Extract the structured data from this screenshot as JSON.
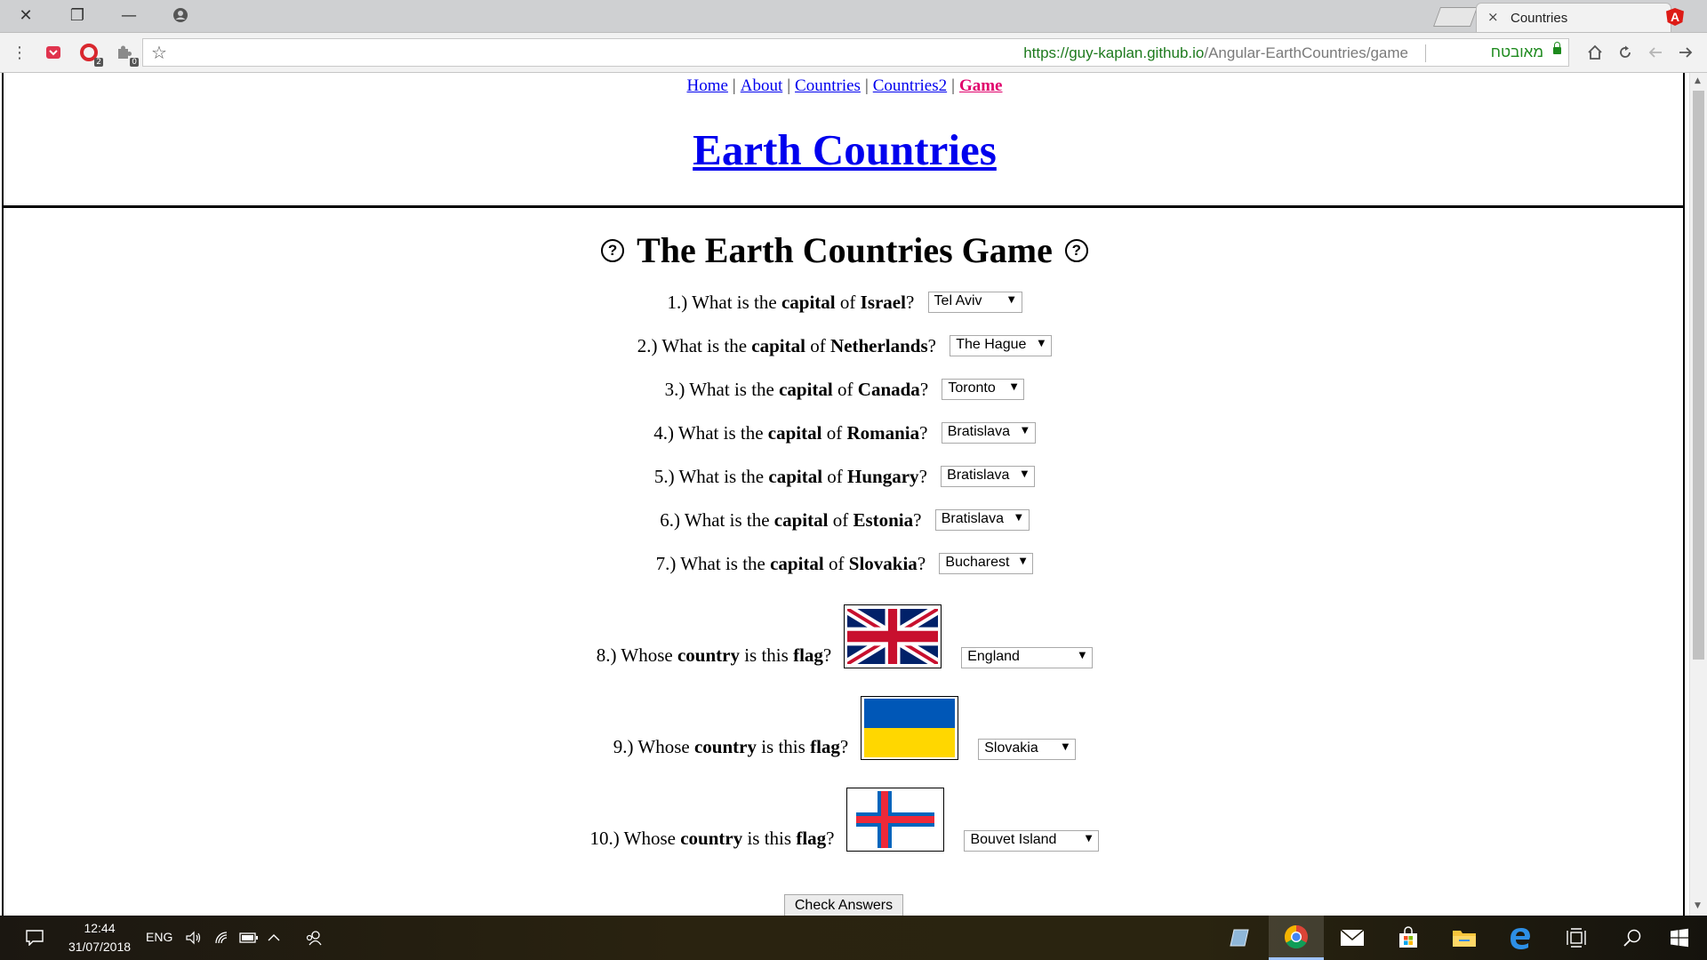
{
  "browser": {
    "tab_title": "Countries",
    "tab_close": "×",
    "favicon_letter": "A",
    "url_host": "https://guy-kaplan.github.io",
    "url_path": "/Angular-EarthCountries/game",
    "secure_label": "מאובטח",
    "window_controls": {
      "close": "✕",
      "restore": "❐",
      "minimize": "—"
    },
    "extension_badges": [
      "2",
      "0"
    ]
  },
  "page": {
    "nav": [
      {
        "label": "Home",
        "active": false
      },
      {
        "label": "About",
        "active": false
      },
      {
        "label": "Countries",
        "active": false
      },
      {
        "label": "Countries2",
        "active": false
      },
      {
        "label": "Game",
        "active": true
      }
    ],
    "nav_separator": "|",
    "site_title": "Earth Countries",
    "game_title": "The Earth Countries Game",
    "help_glyph": "?",
    "capital_questions": [
      {
        "num": "1.)",
        "pre": "What is the",
        "bold1": "capital",
        "mid": "of",
        "bold2": "Israel",
        "post": "?",
        "answer": "Tel Aviv"
      },
      {
        "num": "2.)",
        "pre": "What is the",
        "bold1": "capital",
        "mid": "of",
        "bold2": "Netherlands",
        "post": "?",
        "answer": "The Hague"
      },
      {
        "num": "3.)",
        "pre": "What is the",
        "bold1": "capital",
        "mid": "of",
        "bold2": "Canada",
        "post": "?",
        "answer": "Toronto"
      },
      {
        "num": "4.)",
        "pre": "What is the",
        "bold1": "capital",
        "mid": "of",
        "bold2": "Romania",
        "post": "?",
        "answer": "Bratislava"
      },
      {
        "num": "5.)",
        "pre": "What is the",
        "bold1": "capital",
        "mid": "of",
        "bold2": "Hungary",
        "post": "?",
        "answer": "Bratislava"
      },
      {
        "num": "6.)",
        "pre": "What is the",
        "bold1": "capital",
        "mid": "of",
        "bold2": "Estonia",
        "post": "?",
        "answer": "Bratislava"
      },
      {
        "num": "7.)",
        "pre": "What is the",
        "bold1": "capital",
        "mid": "of",
        "bold2": "Slovakia",
        "post": "?",
        "answer": "Bucharest"
      }
    ],
    "flag_questions": [
      {
        "num": "8.)",
        "pre": "Whose",
        "bold1": "country",
        "mid": "is this",
        "bold2": "flag",
        "post": "?",
        "flag": "united-kingdom-flag",
        "answer": "England"
      },
      {
        "num": "9.)",
        "pre": "Whose",
        "bold1": "country",
        "mid": "is this",
        "bold2": "flag",
        "post": "?",
        "flag": "ukraine-flag",
        "answer": "Slovakia"
      },
      {
        "num": "10.)",
        "pre": "Whose",
        "bold1": "country",
        "mid": "is this",
        "bold2": "flag",
        "post": "?",
        "flag": "faroe-islands-flag",
        "answer": "Bouvet Island"
      }
    ],
    "check_button": "Check Answers"
  },
  "taskbar": {
    "time": "12:44",
    "date": "31/07/2018",
    "language": "ENG"
  },
  "colors": {
    "link": "#0000ee",
    "active_link": "#e0006b",
    "secure_green": "#1d8a1d",
    "taskbar": "#241f10"
  }
}
